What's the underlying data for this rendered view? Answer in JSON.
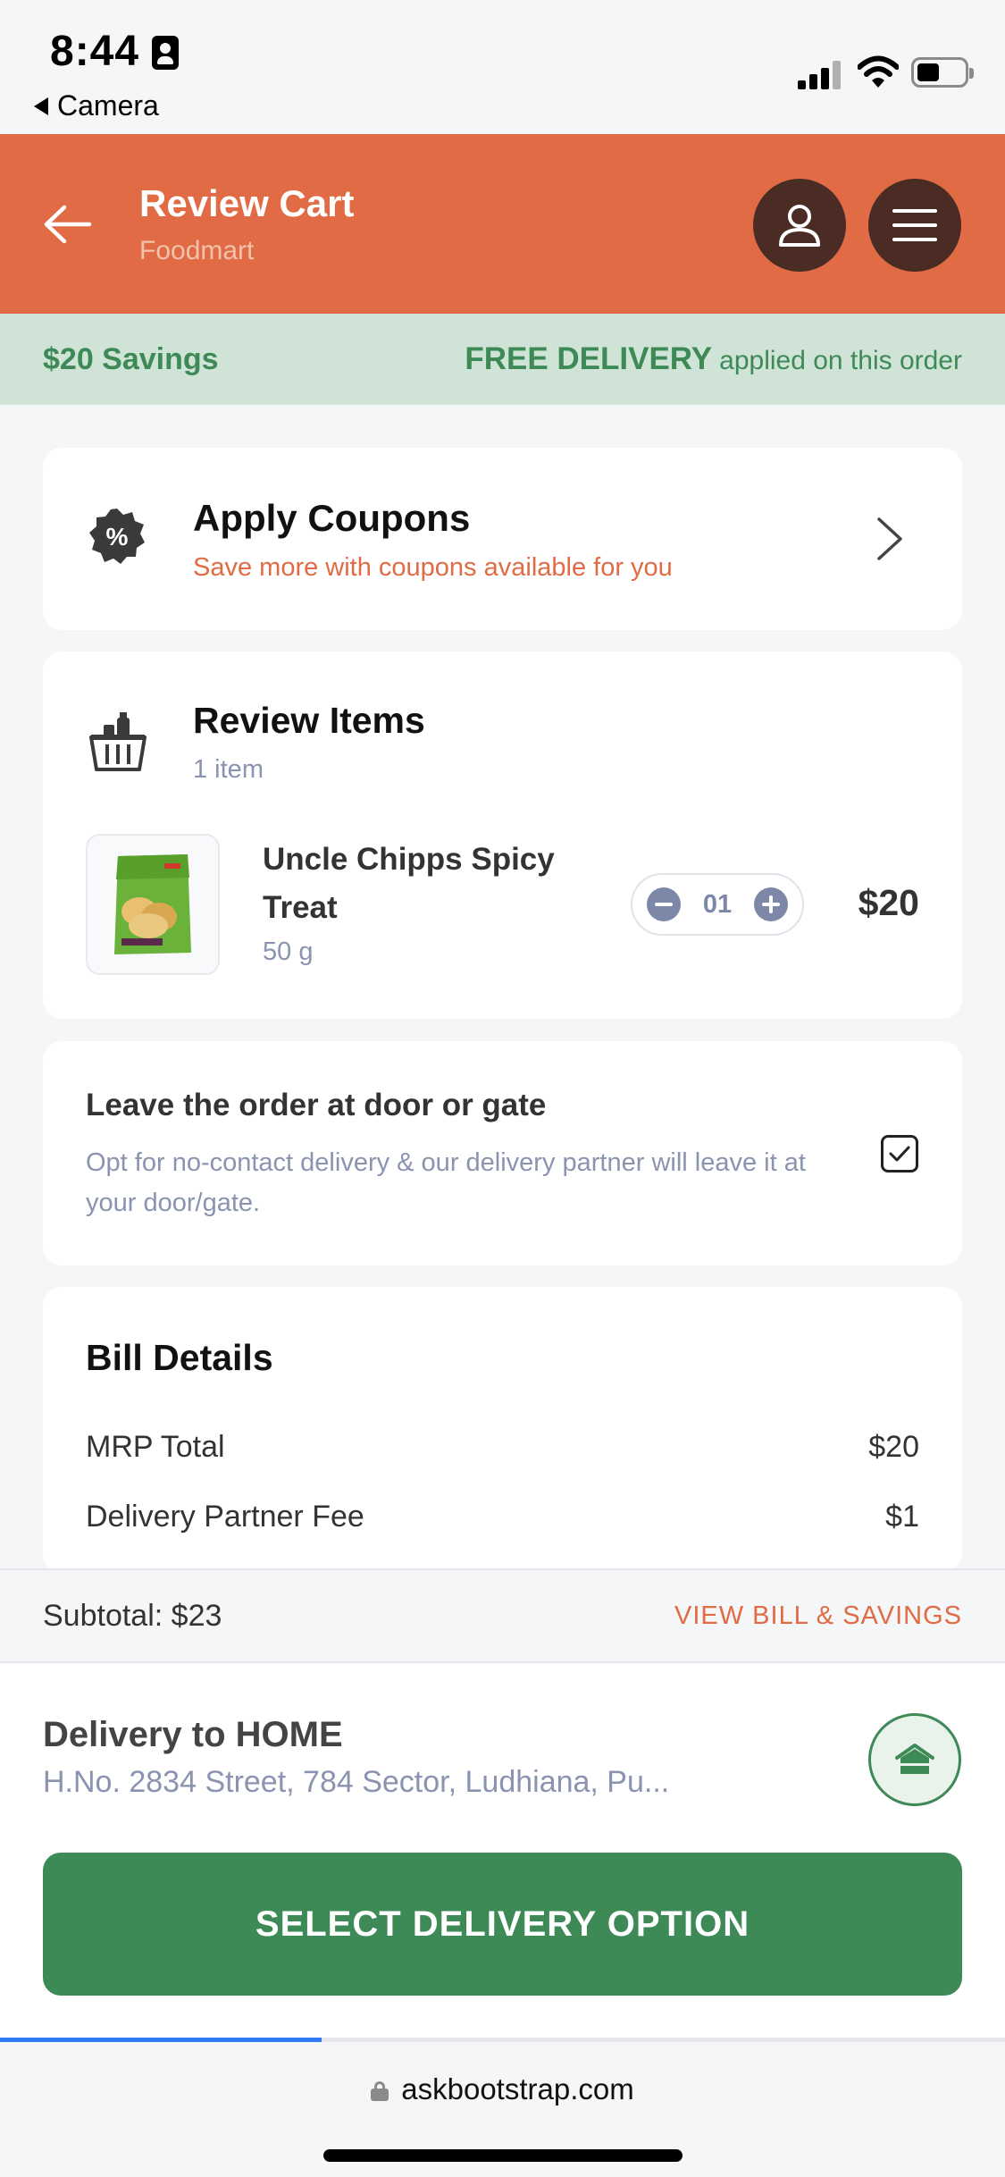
{
  "status_bar": {
    "time": "8:44",
    "back_app": "Camera"
  },
  "header": {
    "title": "Review Cart",
    "subtitle": "Foodmart",
    "colors": {
      "header_bg": "#e06b44",
      "button_bg": "#4a2c24"
    }
  },
  "savings_banner": {
    "savings_text": "$20 Savings",
    "free_delivery": "FREE DELIVERY",
    "applied_text": "applied on this order"
  },
  "coupons": {
    "title": "Apply Coupons",
    "subtitle": "Save more with coupons available for you"
  },
  "review_items": {
    "title": "Review Items",
    "count": "1 item",
    "items": [
      {
        "name": "Uncle Chipps Spicy Treat",
        "weight": "50 g",
        "quantity": "01",
        "price": "$20"
      }
    ]
  },
  "door_option": {
    "title": "Leave the order at door or gate",
    "description": "Opt for no-contact delivery & our delivery partner will leave it at your door/gate.",
    "checked": true
  },
  "bill": {
    "title": "Bill Details",
    "rows": [
      {
        "label": "MRP Total",
        "value": "$20"
      },
      {
        "label": "Delivery Partner Fee",
        "value": "$1"
      }
    ]
  },
  "bottom": {
    "subtotal": "Subtotal: $23",
    "view_bill": "VIEW BILL & SAVINGS",
    "delivery_title": "Delivery to HOME",
    "delivery_address": "H.No. 2834 Street, 784 Sector, Ludhiana, Pu...",
    "select_button": "SELECT DELIVERY OPTION",
    "accent": "#3e8a57"
  },
  "browser": {
    "url": "askbootstrap.com",
    "load_progress": 0.32
  }
}
